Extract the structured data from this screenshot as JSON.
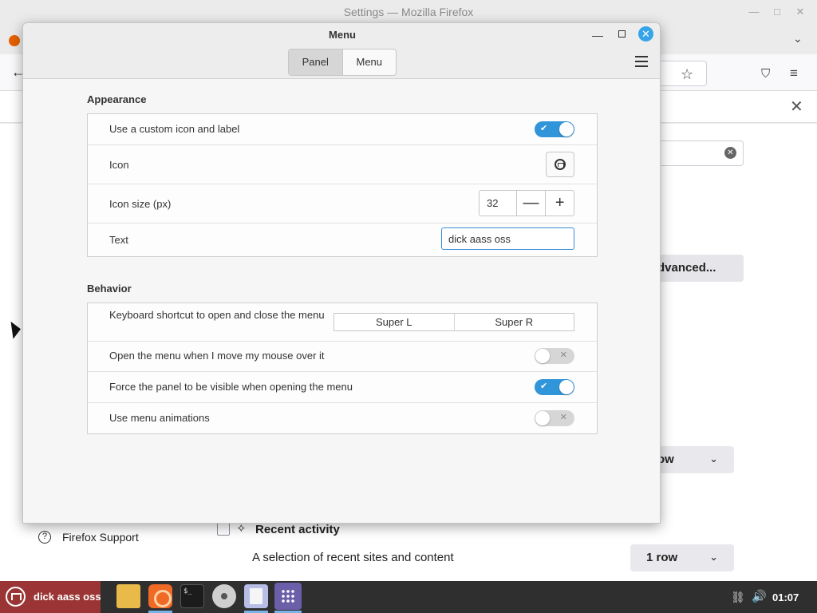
{
  "firefox": {
    "window_title": "Settings — Mozilla Firefox",
    "win_min": "—",
    "win_max": "□",
    "win_close": "✕",
    "tab_list": "⌄",
    "back": "←",
    "star": "☆",
    "pocket": "⛉",
    "menu": "≡",
    "notif_close": "✕",
    "search_clear": "✕",
    "advanced_label": "dvanced...",
    "row_select_1": "ow",
    "row_select_2": "1 row",
    "chevron": "⌄",
    "support_label": "Firefox Support",
    "support_icon_glyph": "?",
    "recent_activity_label": "Recent activity",
    "recent_activity_icon": "✧",
    "recent_activity_desc": "A selection of recent sites and content"
  },
  "dialog": {
    "title": "Menu",
    "min": "—",
    "close": "✕",
    "tabs": [
      {
        "label": "Panel",
        "active": true
      },
      {
        "label": "Menu",
        "active": false
      }
    ],
    "appearance": {
      "title": "Appearance",
      "custom_icon_label": "Use a custom icon and label",
      "custom_icon_enabled": true,
      "icon_label": "Icon",
      "icon_size_label": "Icon size (px)",
      "icon_size_value": "32",
      "decrement": "—",
      "increment": "+",
      "text_label": "Text",
      "text_value": "dick aass oss"
    },
    "behavior": {
      "title": "Behavior",
      "shortcut_label": "Keyboard shortcut to open and close the menu",
      "shortcut_1": "Super L",
      "shortcut_2": "Super R",
      "hover_label": "Open the menu when I move my mouse over it",
      "hover_enabled": false,
      "force_panel_label": "Force the panel to be visible when opening the menu",
      "force_panel_enabled": true,
      "animations_label": "Use menu animations",
      "animations_enabled": false
    },
    "toggle_on_mark": "✔",
    "toggle_off_mark": "✕"
  },
  "taskbar": {
    "menu_label": "dick aass oss",
    "terminal_glyph": "$_",
    "network_icon": "⛓",
    "volume_icon": "🔊",
    "clock": "01:07"
  },
  "colors": {
    "accent": "#3195d9",
    "close_button": "#35a4e8",
    "menu_applet_bg": "#9b3535",
    "taskbar_bg": "#2f2f2f"
  }
}
